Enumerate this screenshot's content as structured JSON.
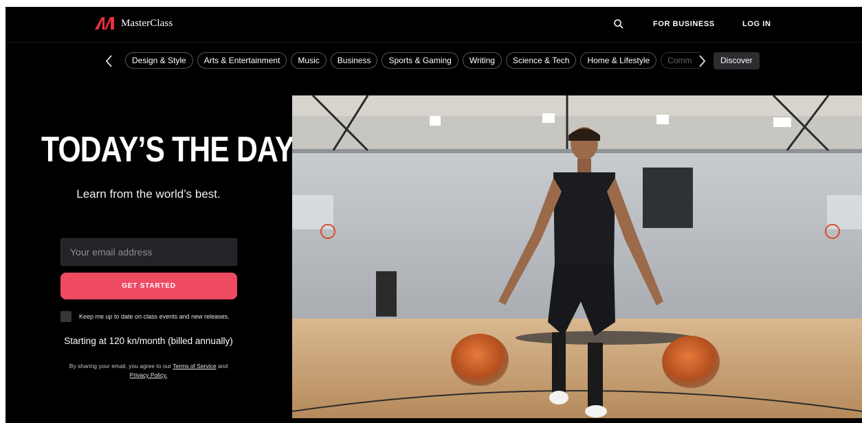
{
  "header": {
    "logo_text": "MasterClass",
    "search_icon": "search-icon",
    "for_business": "FOR BUSINESS",
    "log_in": "LOG IN"
  },
  "categories": {
    "items": [
      "Design & Style",
      "Arts & Entertainment",
      "Music",
      "Business",
      "Sports & Gaming",
      "Writing",
      "Science & Tech",
      "Home & Lifestyle",
      "Comm"
    ],
    "discover": "Discover"
  },
  "hero": {
    "headline": "TODAY’S THE DAY.",
    "subheadline": "Learn from the world’s best.",
    "email_placeholder": "Your email address",
    "cta": "GET STARTED",
    "checkbox_label": "Keep me up to date on class events and new releases.",
    "price": "Starting at 120 kn/month (billed annually)",
    "legal_prefix": "By sharing your email, you agree to our",
    "terms": "Terms of Service",
    "legal_and": "and",
    "privacy": "Privacy Policy."
  },
  "colors": {
    "accent": "#ee4b63",
    "background": "#000000"
  }
}
